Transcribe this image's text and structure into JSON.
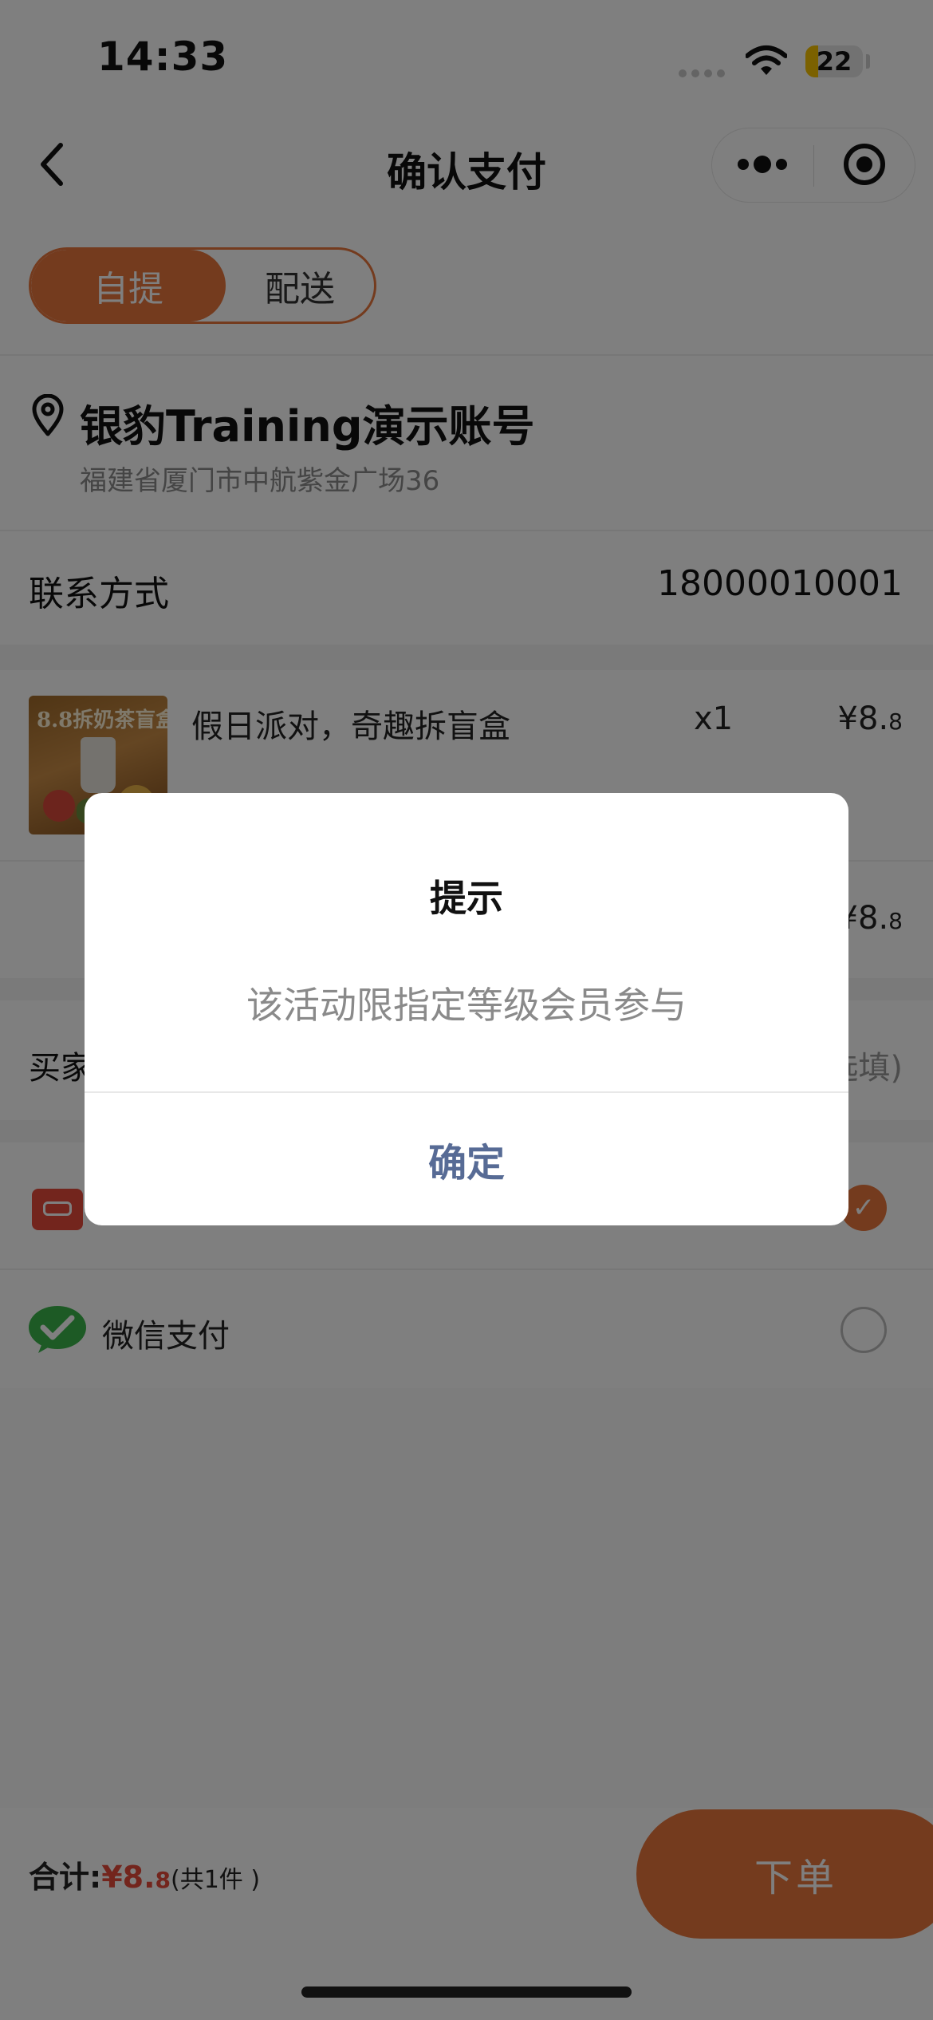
{
  "status_bar": {
    "time": "14:33",
    "battery": "22"
  },
  "nav": {
    "title": "确认支付"
  },
  "delivery_toggle": {
    "pickup": "自提",
    "delivery": "配送"
  },
  "store": {
    "name": "银豹Training演示账号",
    "address": "福建省厦门市中航紫金广场36"
  },
  "contact": {
    "label": "联系方式",
    "value": "18000010001"
  },
  "product": {
    "name": "假日派对，奇趣拆盲盒",
    "image_text": "8.8拆奶茶盲盒",
    "qty": "x1",
    "price_main": "¥8.",
    "price_decimal": "8"
  },
  "subtotal": {
    "price_main": "¥8.",
    "price_decimal": "8"
  },
  "remark": {
    "label_partial": "买家",
    "hint_partial": "选填)"
  },
  "payment": {
    "wechat_label": "微信支付"
  },
  "footer": {
    "total_label": "合计:",
    "total_main": "¥8.",
    "total_decimal": "8",
    "count": "(共1件 )",
    "order_button": "下单"
  },
  "dialog": {
    "title": "提示",
    "message": "该活动限指定等级会员参与",
    "confirm": "确定"
  },
  "colors": {
    "accent": "#e8763d",
    "price_red": "#e64a3b",
    "dialog_button": "#576b95"
  }
}
